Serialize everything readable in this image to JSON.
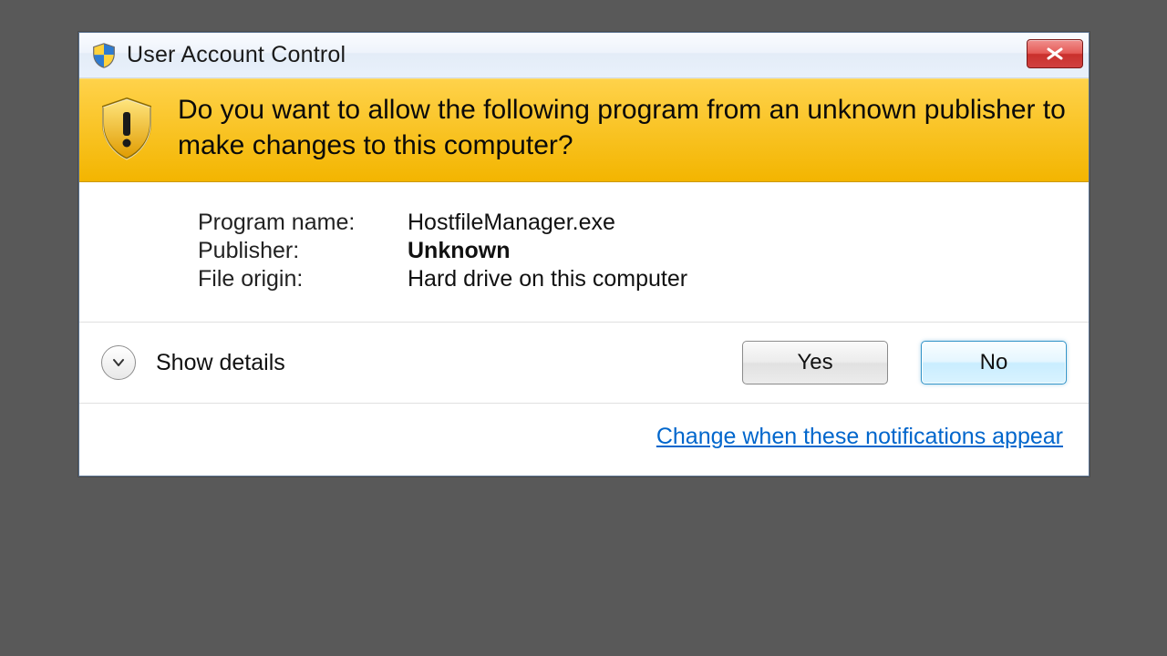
{
  "title": "User Account Control",
  "banner_text": "Do you want to allow the following program from an unknown publisher to make changes to this computer?",
  "details": {
    "program_name_label": "Program name:",
    "program_name_value": "HostfileManager.exe",
    "publisher_label": "Publisher:",
    "publisher_value": "Unknown",
    "file_origin_label": "File origin:",
    "file_origin_value": "Hard drive on this computer"
  },
  "show_details": "Show details",
  "buttons": {
    "yes": "Yes",
    "no": "No"
  },
  "footer_link": "Change when these notifications appear"
}
